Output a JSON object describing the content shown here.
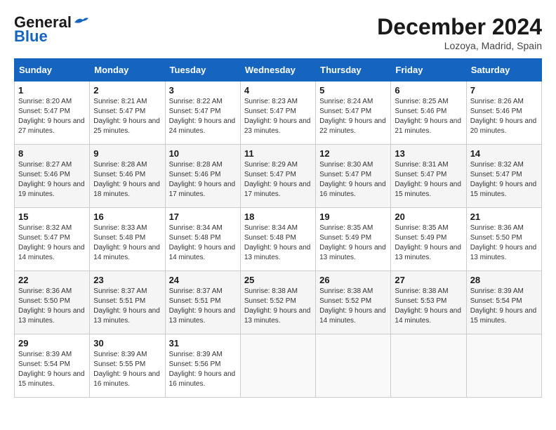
{
  "header": {
    "logo_line1": "General",
    "logo_line2": "Blue",
    "month": "December 2024",
    "location": "Lozoya, Madrid, Spain"
  },
  "days_of_week": [
    "Sunday",
    "Monday",
    "Tuesday",
    "Wednesday",
    "Thursday",
    "Friday",
    "Saturday"
  ],
  "weeks": [
    [
      {
        "day": "1",
        "sunrise": "8:20 AM",
        "sunset": "5:47 PM",
        "daylight": "9 hours and 27 minutes."
      },
      {
        "day": "2",
        "sunrise": "8:21 AM",
        "sunset": "5:47 PM",
        "daylight": "9 hours and 25 minutes."
      },
      {
        "day": "3",
        "sunrise": "8:22 AM",
        "sunset": "5:47 PM",
        "daylight": "9 hours and 24 minutes."
      },
      {
        "day": "4",
        "sunrise": "8:23 AM",
        "sunset": "5:47 PM",
        "daylight": "9 hours and 23 minutes."
      },
      {
        "day": "5",
        "sunrise": "8:24 AM",
        "sunset": "5:47 PM",
        "daylight": "9 hours and 22 minutes."
      },
      {
        "day": "6",
        "sunrise": "8:25 AM",
        "sunset": "5:46 PM",
        "daylight": "9 hours and 21 minutes."
      },
      {
        "day": "7",
        "sunrise": "8:26 AM",
        "sunset": "5:46 PM",
        "daylight": "9 hours and 20 minutes."
      }
    ],
    [
      {
        "day": "8",
        "sunrise": "8:27 AM",
        "sunset": "5:46 PM",
        "daylight": "9 hours and 19 minutes."
      },
      {
        "day": "9",
        "sunrise": "8:28 AM",
        "sunset": "5:46 PM",
        "daylight": "9 hours and 18 minutes."
      },
      {
        "day": "10",
        "sunrise": "8:28 AM",
        "sunset": "5:46 PM",
        "daylight": "9 hours and 17 minutes."
      },
      {
        "day": "11",
        "sunrise": "8:29 AM",
        "sunset": "5:47 PM",
        "daylight": "9 hours and 17 minutes."
      },
      {
        "day": "12",
        "sunrise": "8:30 AM",
        "sunset": "5:47 PM",
        "daylight": "9 hours and 16 minutes."
      },
      {
        "day": "13",
        "sunrise": "8:31 AM",
        "sunset": "5:47 PM",
        "daylight": "9 hours and 15 minutes."
      },
      {
        "day": "14",
        "sunrise": "8:32 AM",
        "sunset": "5:47 PM",
        "daylight": "9 hours and 15 minutes."
      }
    ],
    [
      {
        "day": "15",
        "sunrise": "8:32 AM",
        "sunset": "5:47 PM",
        "daylight": "9 hours and 14 minutes."
      },
      {
        "day": "16",
        "sunrise": "8:33 AM",
        "sunset": "5:48 PM",
        "daylight": "9 hours and 14 minutes."
      },
      {
        "day": "17",
        "sunrise": "8:34 AM",
        "sunset": "5:48 PM",
        "daylight": "9 hours and 14 minutes."
      },
      {
        "day": "18",
        "sunrise": "8:34 AM",
        "sunset": "5:48 PM",
        "daylight": "9 hours and 13 minutes."
      },
      {
        "day": "19",
        "sunrise": "8:35 AM",
        "sunset": "5:49 PM",
        "daylight": "9 hours and 13 minutes."
      },
      {
        "day": "20",
        "sunrise": "8:35 AM",
        "sunset": "5:49 PM",
        "daylight": "9 hours and 13 minutes."
      },
      {
        "day": "21",
        "sunrise": "8:36 AM",
        "sunset": "5:50 PM",
        "daylight": "9 hours and 13 minutes."
      }
    ],
    [
      {
        "day": "22",
        "sunrise": "8:36 AM",
        "sunset": "5:50 PM",
        "daylight": "9 hours and 13 minutes."
      },
      {
        "day": "23",
        "sunrise": "8:37 AM",
        "sunset": "5:51 PM",
        "daylight": "9 hours and 13 minutes."
      },
      {
        "day": "24",
        "sunrise": "8:37 AM",
        "sunset": "5:51 PM",
        "daylight": "9 hours and 13 minutes."
      },
      {
        "day": "25",
        "sunrise": "8:38 AM",
        "sunset": "5:52 PM",
        "daylight": "9 hours and 13 minutes."
      },
      {
        "day": "26",
        "sunrise": "8:38 AM",
        "sunset": "5:52 PM",
        "daylight": "9 hours and 14 minutes."
      },
      {
        "day": "27",
        "sunrise": "8:38 AM",
        "sunset": "5:53 PM",
        "daylight": "9 hours and 14 minutes."
      },
      {
        "day": "28",
        "sunrise": "8:39 AM",
        "sunset": "5:54 PM",
        "daylight": "9 hours and 15 minutes."
      }
    ],
    [
      {
        "day": "29",
        "sunrise": "8:39 AM",
        "sunset": "5:54 PM",
        "daylight": "9 hours and 15 minutes."
      },
      {
        "day": "30",
        "sunrise": "8:39 AM",
        "sunset": "5:55 PM",
        "daylight": "9 hours and 16 minutes."
      },
      {
        "day": "31",
        "sunrise": "8:39 AM",
        "sunset": "5:56 PM",
        "daylight": "9 hours and 16 minutes."
      },
      null,
      null,
      null,
      null
    ]
  ]
}
